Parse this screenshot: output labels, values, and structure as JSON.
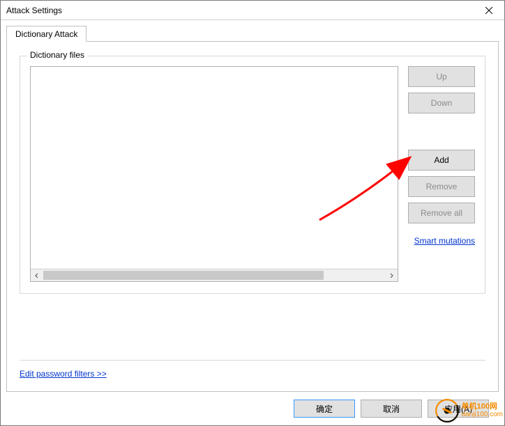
{
  "window": {
    "title": "Attack Settings"
  },
  "tabs": {
    "dictionary": "Dictionary Attack"
  },
  "fieldset": {
    "legend": "Dictionary files"
  },
  "buttons": {
    "up": "Up",
    "down": "Down",
    "add": "Add",
    "remove": "Remove",
    "remove_all": "Remove all"
  },
  "links": {
    "smart_mutations": "Smart mutations",
    "edit_filters": "Edit password filters >>"
  },
  "footer": {
    "ok": "确定",
    "cancel": "取消",
    "apply": "应用(A)"
  },
  "watermark": {
    "line1": "单机100网",
    "line2": "danji100.com"
  }
}
